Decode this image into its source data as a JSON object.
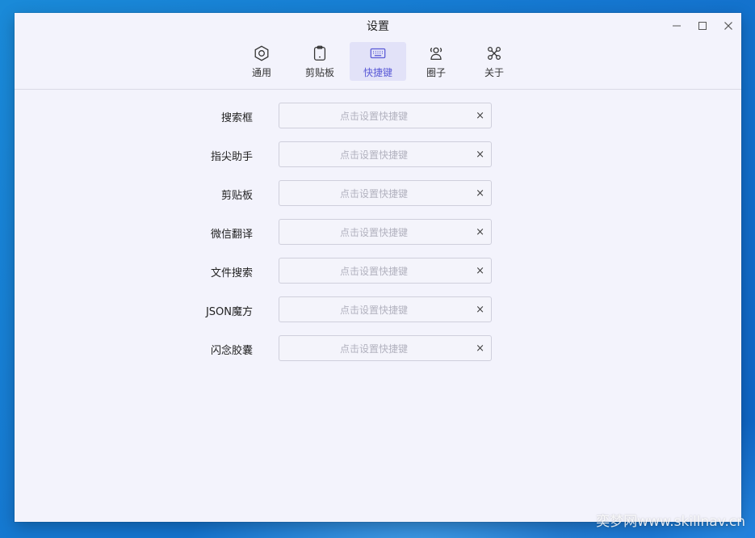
{
  "window": {
    "title": "设置",
    "controls": {
      "minimize": "—",
      "maximize": "☐",
      "close": "✕"
    }
  },
  "tabs": [
    {
      "label": "通用",
      "icon": "hexagon-nut-icon",
      "active": false
    },
    {
      "label": "剪贴板",
      "icon": "clipboard-icon",
      "active": false
    },
    {
      "label": "快捷键",
      "icon": "keyboard-icon",
      "active": true
    },
    {
      "label": "圈子",
      "icon": "group-icon",
      "active": false
    },
    {
      "label": "关于",
      "icon": "command-icon",
      "active": false
    }
  ],
  "hotkeys": {
    "placeholder": "点击设置快捷键",
    "clear": "×",
    "rows": [
      {
        "label": "搜索框"
      },
      {
        "label": "指尖助手"
      },
      {
        "label": "剪贴板"
      },
      {
        "label": "微信翻译"
      },
      {
        "label": "文件搜索"
      },
      {
        "label": "JSON魔方"
      },
      {
        "label": "闪念胶囊"
      }
    ]
  },
  "watermark": "奕梦网www.skillnav.cn",
  "colors": {
    "accent": "#5a5ad6",
    "active_tab_bg": "#e2e2f8",
    "window_bg": "#f3f3fc"
  }
}
